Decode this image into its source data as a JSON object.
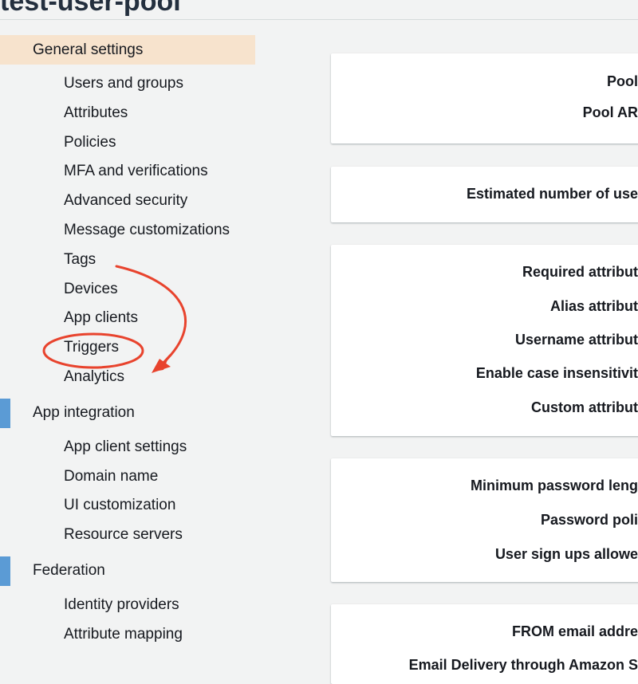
{
  "header": {
    "title": "test-user-pool"
  },
  "sidebar": {
    "sections": [
      {
        "label": "General settings",
        "active": true,
        "items": [
          "Users and groups",
          "Attributes",
          "Policies",
          "MFA and verifications",
          "Advanced security",
          "Message customizations",
          "Tags",
          "Devices",
          "App clients",
          "Triggers",
          "Analytics"
        ]
      },
      {
        "label": "App integration",
        "active": false,
        "items": [
          "App client settings",
          "Domain name",
          "UI customization",
          "Resource servers"
        ]
      },
      {
        "label": "Federation",
        "active": false,
        "items": [
          "Identity providers",
          "Attribute mapping"
        ]
      }
    ]
  },
  "main": {
    "cards": [
      {
        "rows": [
          "Pool",
          "Pool AR"
        ]
      },
      {
        "rows": [
          "Estimated number of use"
        ]
      },
      {
        "rows": [
          "Required attribut",
          "Alias attribut",
          "Username attribut",
          "Enable case insensitivit",
          "Custom attribut"
        ]
      },
      {
        "rows": [
          "Minimum password leng",
          "Password poli",
          "User sign ups allowe"
        ]
      },
      {
        "rows": [
          "FROM email addre",
          "Email Delivery through Amazon S"
        ]
      }
    ]
  },
  "colors": {
    "accent_marker": "#5b9bd5",
    "active_highlight": "#f7e3cd",
    "annotation_red": "#e8432d"
  }
}
